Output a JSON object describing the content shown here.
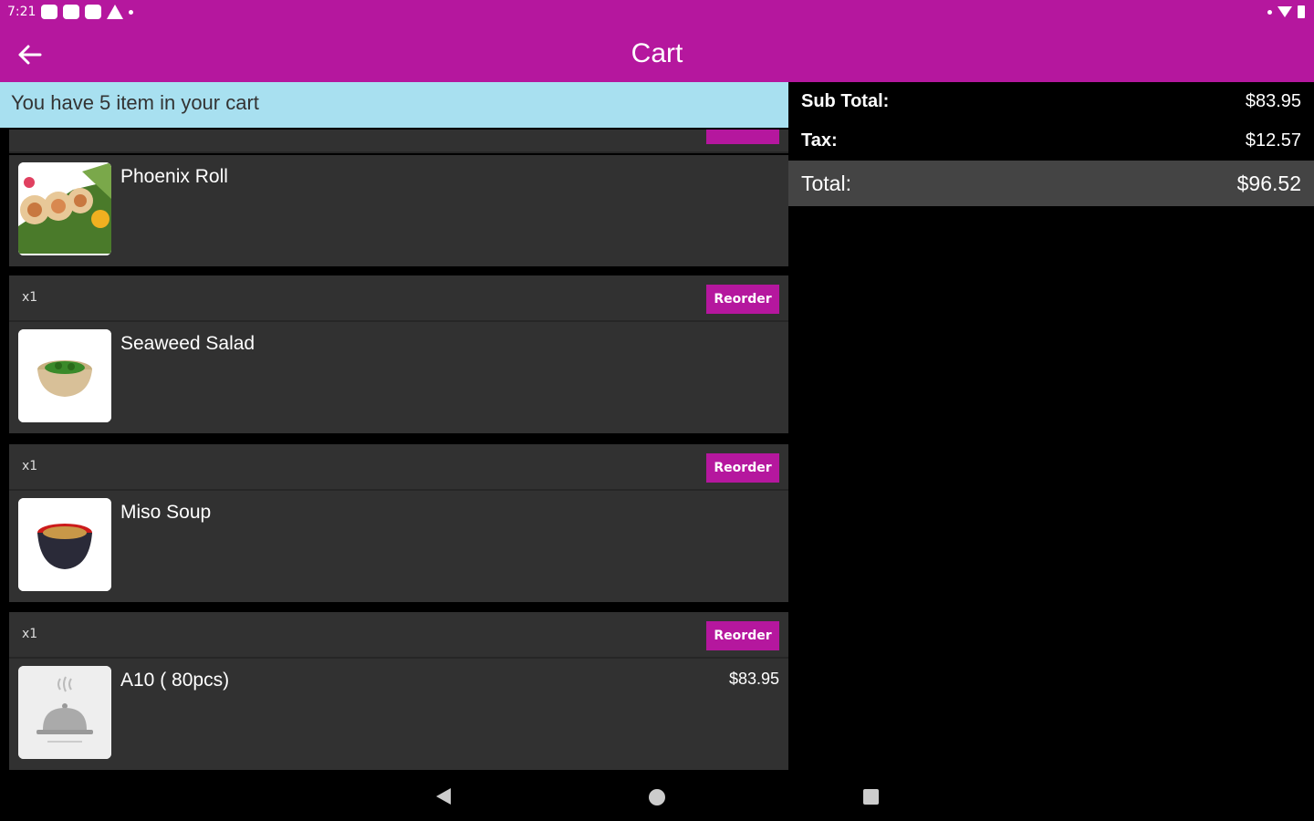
{
  "status_bar": {
    "time": "7:21"
  },
  "app_bar": {
    "title": "Cart"
  },
  "banner": {
    "text": "You have 5 item in your cart"
  },
  "items": [
    {
      "name": "Phoenix Roll",
      "qty": "",
      "reorder_label": "",
      "price": ""
    },
    {
      "name": "Seaweed Salad",
      "qty": "x1",
      "reorder_label": "Reorder",
      "price": ""
    },
    {
      "name": "Miso Soup",
      "qty": "x1",
      "reorder_label": "Reorder",
      "price": ""
    },
    {
      "name": "A10 ( 80pcs)",
      "qty": "x1",
      "reorder_label": "Reorder",
      "price": "$83.95"
    }
  ],
  "summary": {
    "subtotal_label": "Sub Total:",
    "subtotal_value": "$83.95",
    "tax_label": "Tax:",
    "tax_value": "$12.57",
    "total_label": "Total:",
    "total_value": "$96.52"
  },
  "colors": {
    "accent": "#b5179e",
    "banner": "#a8e0f0",
    "card": "#313131",
    "total_row": "#444444"
  }
}
